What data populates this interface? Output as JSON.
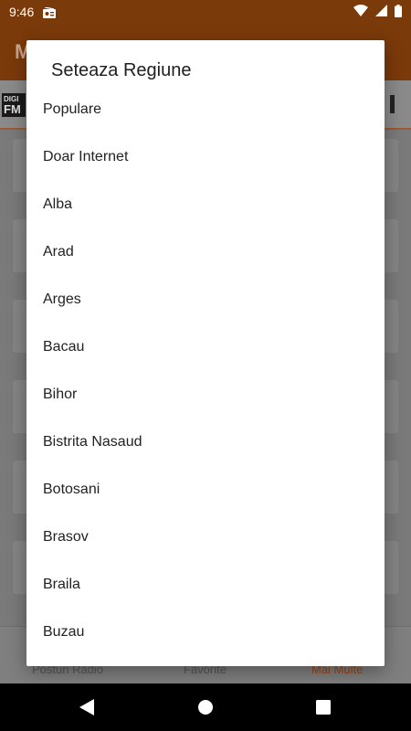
{
  "status_bar": {
    "time": "9:46"
  },
  "toolbar": {
    "title": "M"
  },
  "banner": {
    "logo_top": "DIGI",
    "logo_bottom": "FM"
  },
  "bottom_nav": {
    "tabs": [
      {
        "label": "Posturi Radio"
      },
      {
        "label": "Favorite"
      },
      {
        "label": "Mai Multe"
      }
    ]
  },
  "dialog": {
    "title": "Seteaza Regiune",
    "items": [
      "Populare",
      "Doar Internet",
      "Alba",
      "Arad",
      "Arges",
      "Bacau",
      "Bihor",
      "Bistrita Nasaud",
      "Botosani",
      "Brasov",
      "Braila",
      "Buzau"
    ]
  },
  "colors": {
    "primary": "#7b3a0a",
    "accent": "#e85d1a",
    "scrim_over_primary": "#7b3a0a"
  }
}
